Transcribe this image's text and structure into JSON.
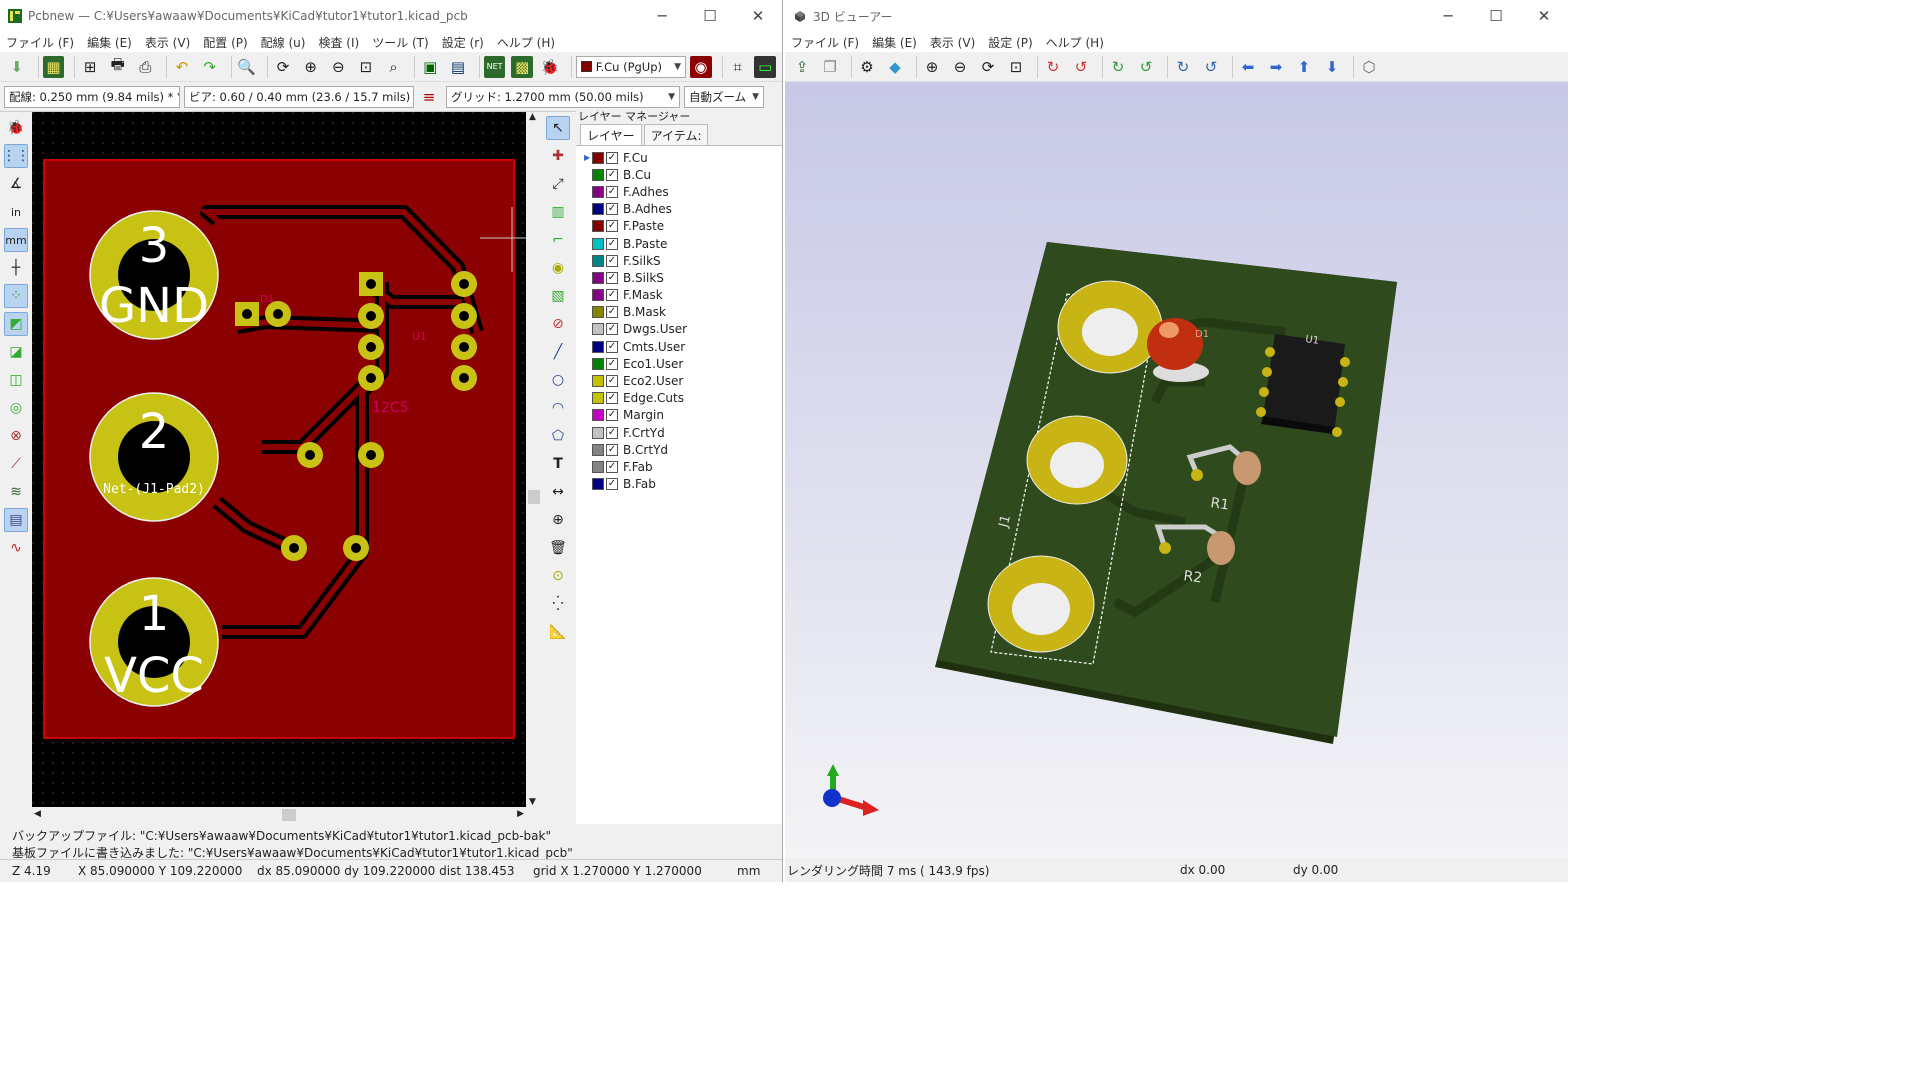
{
  "pcbnew": {
    "title": "Pcbnew — C:¥Users¥awaaw¥Documents¥KiCad¥tutor1¥tutor1.kicad_pcb",
    "menu": [
      "ファイル (F)",
      "編集 (E)",
      "表示 (V)",
      "配置 (P)",
      "配線 (u)",
      "検査 (I)",
      "ツール (T)",
      "設定 (r)",
      "ヘルプ (H)"
    ],
    "layer_select": "F.Cu (PgUp)",
    "track_select": "配線: 0.250 mm (9.84 mils) *",
    "via_select": "ビア: 0.60 / 0.40 mm (23.6 / 15.7 mils) *",
    "grid_select": "グリッド: 1.2700 mm (50.00 mils)",
    "zoom_select": "自動ズーム",
    "units_in": "in",
    "units_mm": "mm",
    "board": {
      "pad3_num": "3",
      "pad3_net": "GND",
      "pad2_num": "2",
      "pad2_net": "Net-(J1-Pad2)",
      "pad1_num": "1",
      "pad1_net": "VCC",
      "ref_d1": "D1",
      "ref_u1": "U1",
      "ref_part": "12C5"
    },
    "layer_manager": {
      "title": "レイヤー マネージャー",
      "tab_layers": "レイヤー",
      "tab_items": "アイテム:",
      "layers": [
        {
          "name": "F.Cu",
          "color": "#840000"
        },
        {
          "name": "B.Cu",
          "color": "#008400"
        },
        {
          "name": "F.Adhes",
          "color": "#840084"
        },
        {
          "name": "B.Adhes",
          "color": "#000084"
        },
        {
          "name": "F.Paste",
          "color": "#840000"
        },
        {
          "name": "B.Paste",
          "color": "#00c2c2"
        },
        {
          "name": "F.SilkS",
          "color": "#008484"
        },
        {
          "name": "B.SilkS",
          "color": "#840084"
        },
        {
          "name": "F.Mask",
          "color": "#840084"
        },
        {
          "name": "B.Mask",
          "color": "#848400"
        },
        {
          "name": "Dwgs.User",
          "color": "#c2c2c2"
        },
        {
          "name": "Cmts.User",
          "color": "#000084"
        },
        {
          "name": "Eco1.User",
          "color": "#008400"
        },
        {
          "name": "Eco2.User",
          "color": "#c2c200"
        },
        {
          "name": "Edge.Cuts",
          "color": "#c2c200"
        },
        {
          "name": "Margin",
          "color": "#c200c2"
        },
        {
          "name": "F.CrtYd",
          "color": "#c2c2c2"
        },
        {
          "name": "B.CrtYd",
          "color": "#848484"
        },
        {
          "name": "F.Fab",
          "color": "#848484"
        },
        {
          "name": "B.Fab",
          "color": "#000084"
        }
      ]
    },
    "messages": [
      "バックアップファイル: \"C:¥Users¥awaaw¥Documents¥KiCad¥tutor1¥tutor1.kicad_pcb-bak\"",
      "基板ファイルに書き込みました: \"C:¥Users¥awaaw¥Documents¥KiCad¥tutor1¥tutor1.kicad_pcb\""
    ],
    "status": {
      "zoom": "Z 4.19",
      "pos": "X 85.090000  Y 109.220000",
      "delta": "dx 85.090000  dy 109.220000  dist 138.453",
      "grid": "grid X 1.270000  Y 1.270000",
      "units": "mm"
    }
  },
  "viewer3d": {
    "title": "3D ビューアー",
    "menu": [
      "ファイル (F)",
      "編集 (E)",
      "表示 (V)",
      "設定 (P)",
      "ヘルプ (H)"
    ],
    "labels": {
      "j1": "J1",
      "r1": "R1",
      "r2": "R2",
      "u1": "U1",
      "d1": "D1"
    },
    "status": {
      "render": "レンダリング時間 7 ms ( 143.9 fps)",
      "dx": "dx 0.00",
      "dy": "dy 0.00"
    }
  }
}
